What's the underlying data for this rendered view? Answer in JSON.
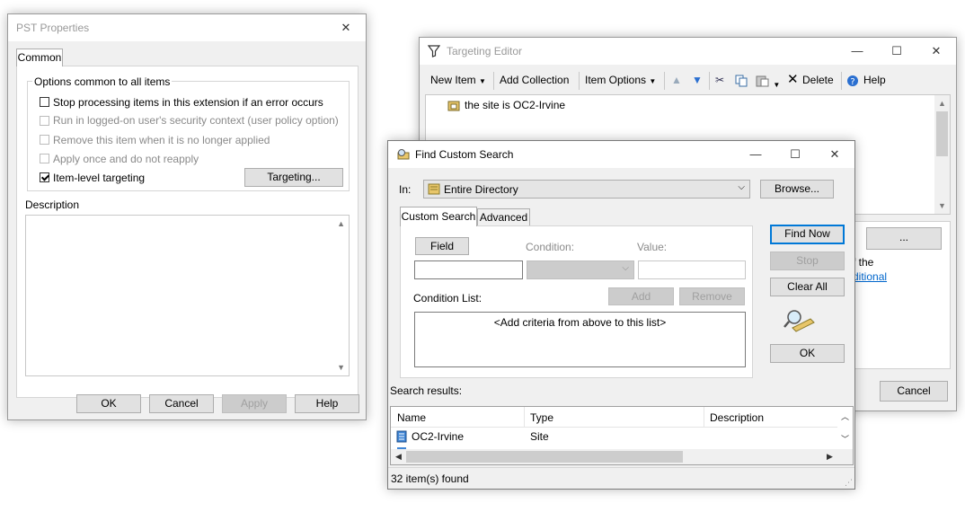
{
  "pst": {
    "title": "PST Properties",
    "tab": "Common",
    "group_label": "Options common to all items",
    "options": [
      {
        "label": "Stop processing items in this extension if an error occurs",
        "checked": false,
        "enabled": true
      },
      {
        "label": "Run in logged-on user's security context (user policy option)",
        "checked": false,
        "enabled": false
      },
      {
        "label": "Remove this item when it is no longer applied",
        "checked": false,
        "enabled": false
      },
      {
        "label": "Apply once and do not reapply",
        "checked": false,
        "enabled": false
      },
      {
        "label": "Item-level targeting",
        "checked": true,
        "enabled": true
      }
    ],
    "targeting_button": "Targeting...",
    "description_label": "Description",
    "buttons": {
      "ok": "OK",
      "cancel": "Cancel",
      "apply": "Apply",
      "help": "Help"
    }
  },
  "targeting": {
    "title": "Targeting Editor",
    "toolbar": {
      "new_item": "New Item",
      "add_collection": "Add Collection",
      "item_options": "Item Options",
      "delete": "Delete",
      "help": "Help"
    },
    "tree_item": "the site is OC2-Irvine",
    "ellipsis_button": "...",
    "partial_text_1": "f the",
    "partial_link": "ditional",
    "cancel": "Cancel"
  },
  "find": {
    "title": "Find Custom Search",
    "in_label": "In:",
    "in_value": "Entire Directory",
    "browse": "Browse...",
    "tabs": {
      "custom": "Custom Search",
      "advanced": "Advanced"
    },
    "field_button": "Field",
    "condition_label": "Condition:",
    "value_label": "Value:",
    "condition_list_label": "Condition List:",
    "add": "Add",
    "remove": "Remove",
    "condition_list_placeholder": "<Add criteria from above to this list>",
    "find_now": "Find Now",
    "stop": "Stop",
    "clear_all": "Clear All",
    "ok": "OK",
    "search_results_label": "Search results:",
    "columns": {
      "name": "Name",
      "type": "Type",
      "description": "Description"
    },
    "rows": [
      {
        "name": "OC2-Irvine",
        "type": "Site",
        "description": ""
      }
    ],
    "status": "32 item(s) found"
  }
}
